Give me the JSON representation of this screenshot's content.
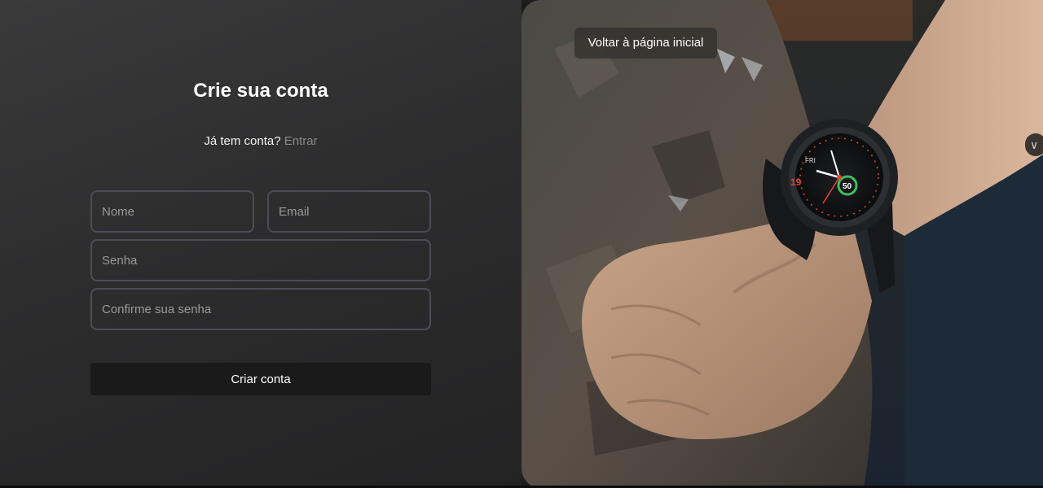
{
  "form": {
    "title": "Crie sua conta",
    "login_prompt": "Já tem conta?",
    "login_link": "Entrar",
    "fields": {
      "name_placeholder": "Nome",
      "email_placeholder": "Email",
      "password_placeholder": "Senha",
      "confirm_placeholder": "Confirme sua senha"
    },
    "submit_label": "Criar conta"
  },
  "hero": {
    "back_label": "Voltar à página inicial",
    "image_subject": "hand with sports smartwatch gripping a rock",
    "watch_face": {
      "left_number": "19",
      "right_number": "50",
      "top_text": "FRI"
    },
    "scroll_icon": "chevron-down-icon"
  },
  "colors": {
    "panel_bg": "#2d2d2e",
    "field_border": "#4c4c55",
    "button_bg": "#1a1a1b",
    "link_muted": "#8a8a8a",
    "watch_accent": "#e8432e",
    "watch_green": "#3fbf5a"
  }
}
